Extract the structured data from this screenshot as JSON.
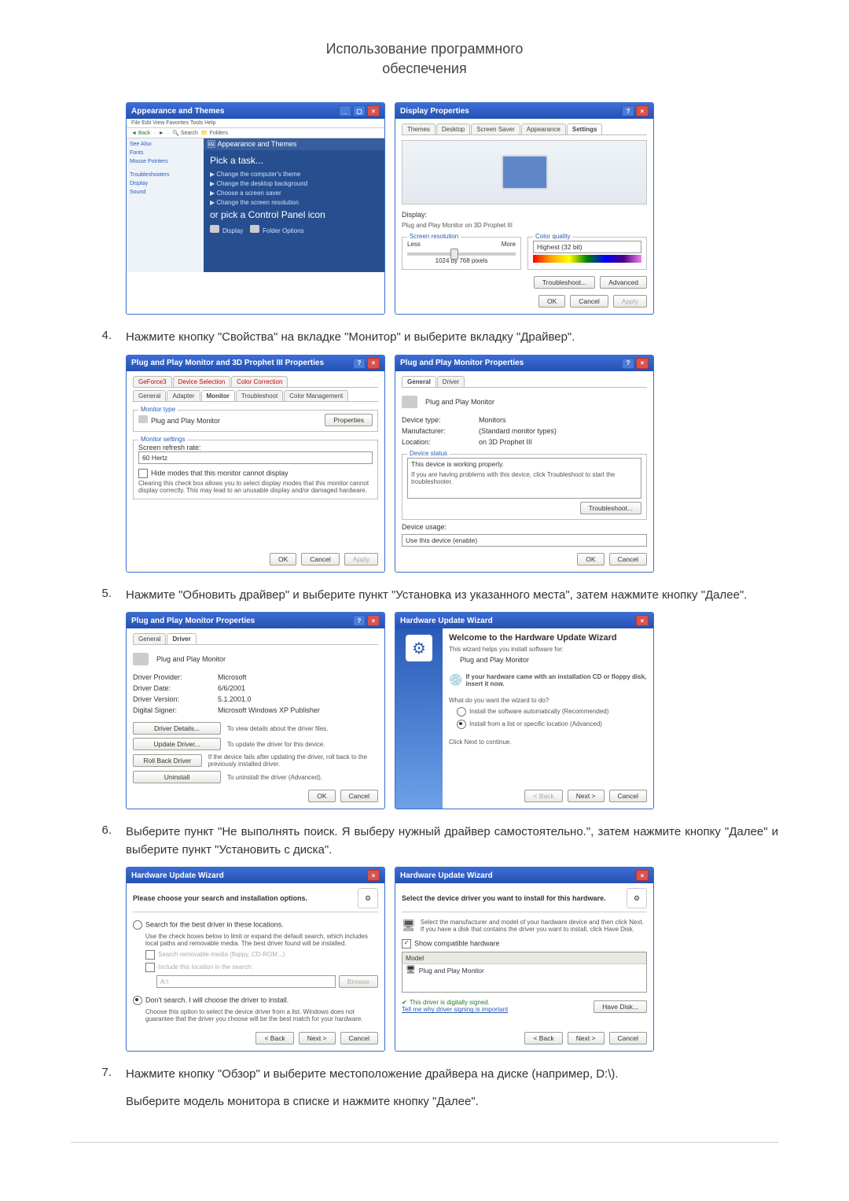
{
  "doc": {
    "title_line1": "Использование программного",
    "title_line2": "обеспечения"
  },
  "steps": {
    "s4_num": "4.",
    "s4_txt": "Нажмите кнопку \"Свойства\" на вкладке \"Монитор\" и выберите вкладку \"Драйвер\".",
    "s5_num": "5.",
    "s5_txt": "Нажмите \"Обновить драйвер\" и выберите пункт \"Установка из указанного места\", затем нажмите кнопку \"Далее\".",
    "s6_num": "6.",
    "s6_txt": "Выберите пункт \"Не выполнять поиск. Я выберу нужный драйвер самостоятельно.\", затем нажмите кнопку \"Далее\" и выберите пункт \"Установить с диска\".",
    "s7_num": "7.",
    "s7_txt": "Нажмите кнопку \"Обзор\" и выберите местоположение драйвера на диске (например, D:\\).",
    "s7_txt2": "Выберите модель монитора в списке и нажмите кнопку \"Далее\"."
  },
  "cp": {
    "title": "Appearance and Themes",
    "pick": "Pick a task...",
    "task1": "Change the computer's theme",
    "task2": "Change the desktop background",
    "task3": "Choose a screen saver",
    "task4": "Change the screen resolution",
    "or": "or pick a Control Panel icon",
    "icon1": "Display",
    "icon2": "Folder Options",
    "sb_seealso": "See Also",
    "sb_trouble": "Troubleshooters"
  },
  "disp": {
    "title": "Display Properties",
    "tabs": [
      "Themes",
      "Desktop",
      "Screen Saver",
      "Appearance",
      "Settings"
    ],
    "display_lbl": "Display:",
    "display_val": "Plug and Play Monitor on 3D Prophet III",
    "res_grp": "Screen resolution",
    "res_less": "Less",
    "res_more": "More",
    "res_val": "1024 by 768 pixels",
    "col_grp": "Color quality",
    "col_val": "Highest (32 bit)",
    "troubleshoot": "Troubleshoot...",
    "advanced": "Advanced",
    "ok": "OK",
    "cancel": "Cancel",
    "apply": "Apply"
  },
  "adv": {
    "title": "Plug and Play Monitor and 3D Prophet III Properties",
    "tabs_top": [
      "GeForce3",
      "Device Selection",
      "Color Correction"
    ],
    "tabs_bot": [
      "General",
      "Adapter",
      "Monitor",
      "Troubleshoot",
      "Color Management"
    ],
    "mon_type": "Monitor type",
    "mon_name": "Plug and Play Monitor",
    "properties": "Properties",
    "mon_set": "Monitor settings",
    "refresh_lbl": "Screen refresh rate:",
    "refresh_val": "60 Hertz",
    "hide": "Hide modes that this monitor cannot display",
    "hide_desc": "Clearing this check box allows you to select display modes that this monitor cannot display correctly. This may lead to an unusable display and/or damaged hardware.",
    "ok": "OK",
    "cancel": "Cancel",
    "apply": "Apply"
  },
  "pnp_gen": {
    "title": "Plug and Play Monitor Properties",
    "tabs": [
      "General",
      "Driver"
    ],
    "name": "Plug and Play Monitor",
    "dt_lbl": "Device type:",
    "dt_val": "Monitors",
    "mf_lbl": "Manufacturer:",
    "mf_val": "(Standard monitor types)",
    "loc_lbl": "Location:",
    "loc_val": "on 3D Prophet III",
    "status_lbl": "Device status",
    "status_val": "This device is working properly.",
    "status_hint": "If you are having problems with this device, click Troubleshoot to start the troubleshooter.",
    "troubleshoot": "Troubleshoot...",
    "usage_lbl": "Device usage:",
    "usage_val": "Use this device (enable)",
    "ok": "OK",
    "cancel": "Cancel"
  },
  "pnp_drv": {
    "title": "Plug and Play Monitor Properties",
    "tabs": [
      "General",
      "Driver"
    ],
    "name": "Plug and Play Monitor",
    "prov_lbl": "Driver Provider:",
    "prov_val": "Microsoft",
    "date_lbl": "Driver Date:",
    "date_val": "6/6/2001",
    "ver_lbl": "Driver Version:",
    "ver_val": "5.1.2001.0",
    "sig_lbl": "Digital Signer:",
    "sig_val": "Microsoft Windows XP Publisher",
    "btn_details": "Driver Details...",
    "btn_details_d": "To view details about the driver files.",
    "btn_update": "Update Driver...",
    "btn_update_d": "To update the driver for this device.",
    "btn_roll": "Roll Back Driver",
    "btn_roll_d": "If the device fails after updating the driver, roll back to the previously installed driver.",
    "btn_uninst": "Uninstall",
    "btn_uninst_d": "To uninstall the driver (Advanced).",
    "ok": "OK",
    "cancel": "Cancel"
  },
  "wiz1": {
    "title": "Hardware Update Wizard",
    "h": "Welcome to the Hardware Update Wizard",
    "p": "This wizard helps you install software for:",
    "dev": "Plug and Play Monitor",
    "cd": "If your hardware came with an installation CD or floppy disk, insert it now.",
    "q": "What do you want the wizard to do?",
    "r1": "Install the software automatically (Recommended)",
    "r2": "Install from a list or specific location (Advanced)",
    "cont": "Click Next to continue.",
    "back": "< Back",
    "next": "Next >",
    "cancel": "Cancel"
  },
  "wiz2": {
    "title": "Hardware Update Wizard",
    "h": "Please choose your search and installation options.",
    "r1": "Search for the best driver in these locations.",
    "r1d": "Use the check boxes below to limit or expand the default search, which includes local paths and removable media. The best driver found will be installed.",
    "c1": "Search removable media (floppy, CD-ROM...)",
    "c2": "Include this location in the search:",
    "path": "A:\\",
    "browse": "Browse",
    "r2": "Don't search. I will choose the driver to install.",
    "r2d": "Choose this option to select the device driver from a list. Windows does not guarantee that the driver you choose will be the best match for your hardware.",
    "back": "< Back",
    "next": "Next >",
    "cancel": "Cancel"
  },
  "wiz3": {
    "title": "Hardware Update Wizard",
    "h": "Select the device driver you want to install for this hardware.",
    "d": "Select the manufacturer and model of your hardware device and then click Next. If you have a disk that contains the driver you want to install, click Have Disk.",
    "chk": "Show compatible hardware",
    "model_lbl": "Model",
    "model_val": "Plug and Play Monitor",
    "signed": "This driver is digitally signed.",
    "tell": "Tell me why driver signing is important",
    "havedisk": "Have Disk...",
    "back": "< Back",
    "next": "Next >",
    "cancel": "Cancel"
  }
}
